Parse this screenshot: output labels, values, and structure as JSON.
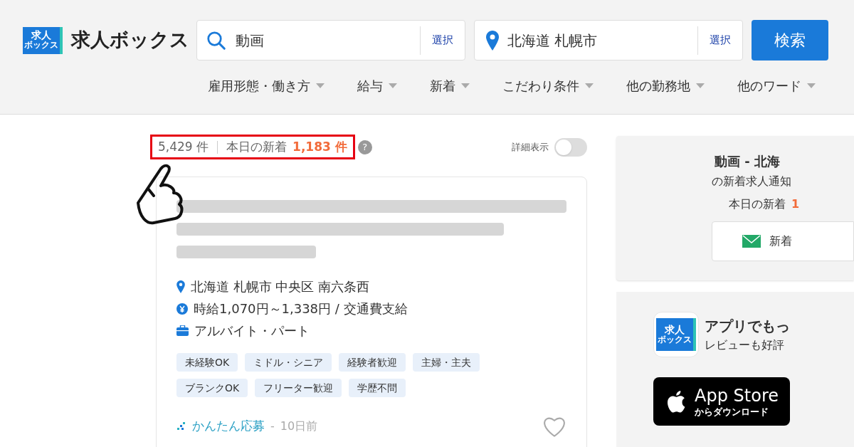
{
  "header": {
    "logo_text": "求人ボックス",
    "logo_badge_top": "求人",
    "logo_badge_bottom": "ボックス",
    "keyword": {
      "value": "動画",
      "select": "選択"
    },
    "location": {
      "value": "北海道 札幌市",
      "select": "選択"
    },
    "search_button": "検索",
    "filters": [
      "雇用形態・働き方",
      "給与",
      "新着",
      "こだわり条件",
      "他の勤務地",
      "他のワード"
    ]
  },
  "results": {
    "total": "5,429 件",
    "today_label": "本日の新着",
    "today_count": "1,183 件",
    "help": "?",
    "highlighted": true
  },
  "detail_toggle": {
    "label": "詳細表示",
    "on": false
  },
  "job": {
    "location": "北海道 札幌市 中央区 南六条西",
    "salary": "時給1,070円～1,338円 / 交通費支給",
    "type": "アルバイト・パート",
    "tags": [
      "未経験OK",
      "ミドル・シニア",
      "経験者歓迎",
      "主婦・主夫",
      "ブランクOK",
      "フリーター歓迎",
      "学歴不問"
    ],
    "apply": "かんたん応募",
    "separator": "-",
    "age": "10日前",
    "favorite": false
  },
  "alert_panel": {
    "title": "動画 - 北海",
    "subtitle": "の新着求人通知",
    "today_label": "本日の新着",
    "today_count": "1",
    "button": "新着"
  },
  "app_panel": {
    "title": "アプリでもっ",
    "subtitle": "レビューも好評",
    "badge_top": "求人",
    "badge_bottom": "ボックス",
    "store_title": "App Store",
    "store_sub": "からダウンロード"
  }
}
